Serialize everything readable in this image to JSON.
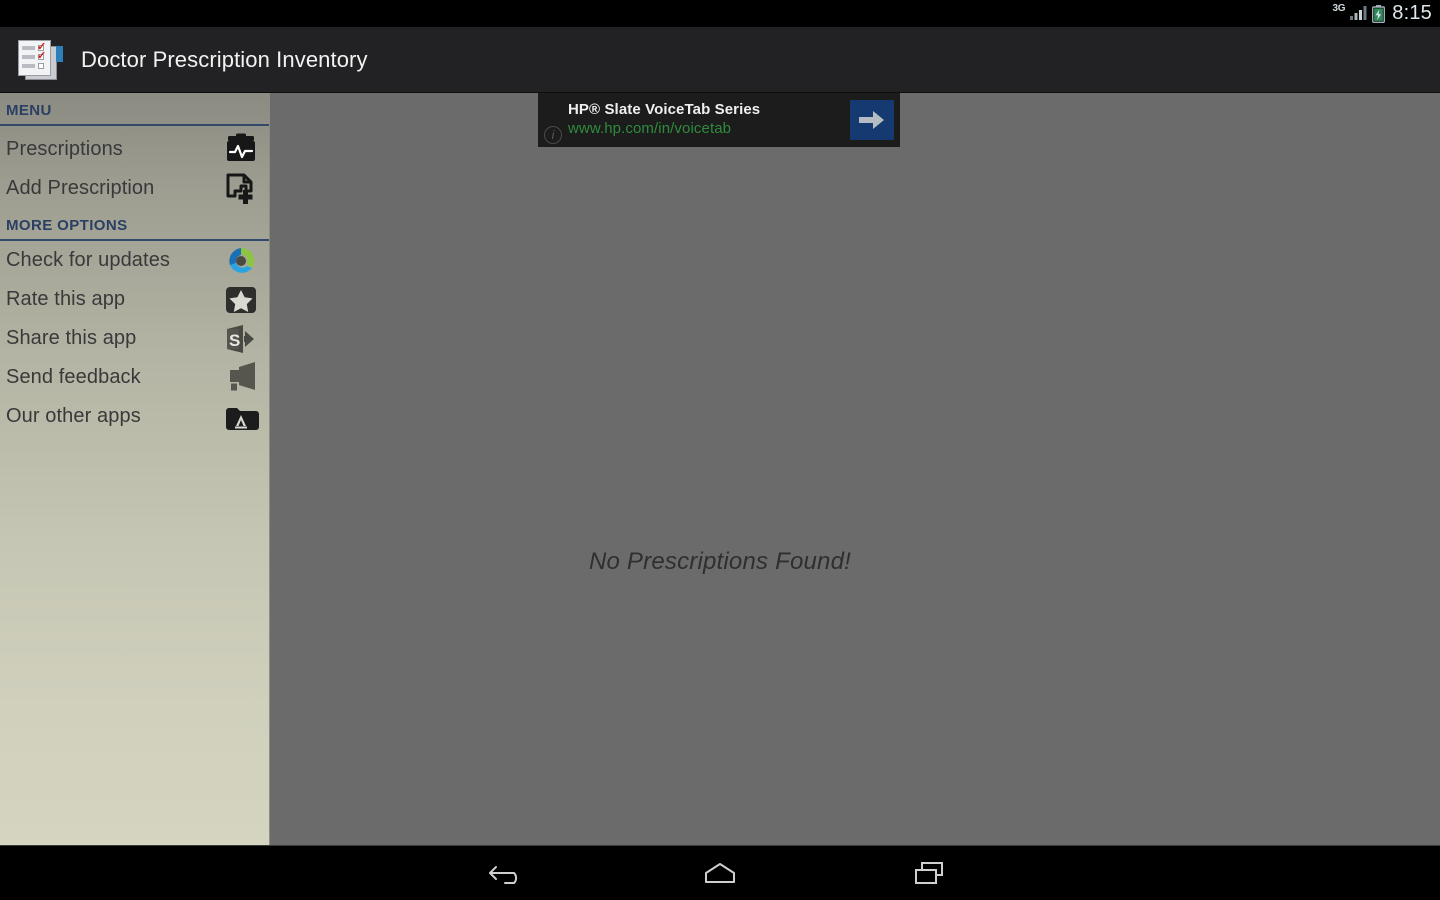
{
  "status_bar": {
    "network_label": "3G",
    "signal_icon": "signal-bars-icon",
    "battery_icon": "battery-charging-icon",
    "time": "8:15"
  },
  "action_bar": {
    "app_icon": "clipboard-checklist-icon",
    "title": "Doctor Prescription Inventory"
  },
  "drawer": {
    "sections": [
      {
        "header": "MENU",
        "items": [
          {
            "label": "Prescriptions",
            "icon": "clipboard-pulse-icon"
          },
          {
            "label": "Add Prescription",
            "icon": "document-plus-icon"
          }
        ]
      },
      {
        "header": "MORE OPTIONS",
        "items": [
          {
            "label": "Check for updates",
            "icon": "refresh-circle-icon"
          },
          {
            "label": "Rate this app",
            "icon": "star-icon"
          },
          {
            "label": "Share this app",
            "icon": "share-icon"
          },
          {
            "label": "Send feedback",
            "icon": "megaphone-icon"
          },
          {
            "label": "Our other apps",
            "icon": "app-folder-icon"
          }
        ]
      }
    ]
  },
  "content": {
    "empty_message": "No Prescriptions Found!"
  },
  "ad": {
    "title": "HP® Slate VoiceTab Series",
    "url": "www.hp.com/in/voicetab",
    "info_icon": "info-circle-icon",
    "cta_icon": "arrow-right-icon",
    "cta_color": "#153a72"
  },
  "nav_bar": {
    "back": "back-icon",
    "home": "home-icon",
    "recents": "recents-icon"
  },
  "colors": {
    "action_bar": "#222224",
    "scrim": "#6b6b6b",
    "section_header": "#2a3f63",
    "ad_url": "#2e8b3d"
  }
}
